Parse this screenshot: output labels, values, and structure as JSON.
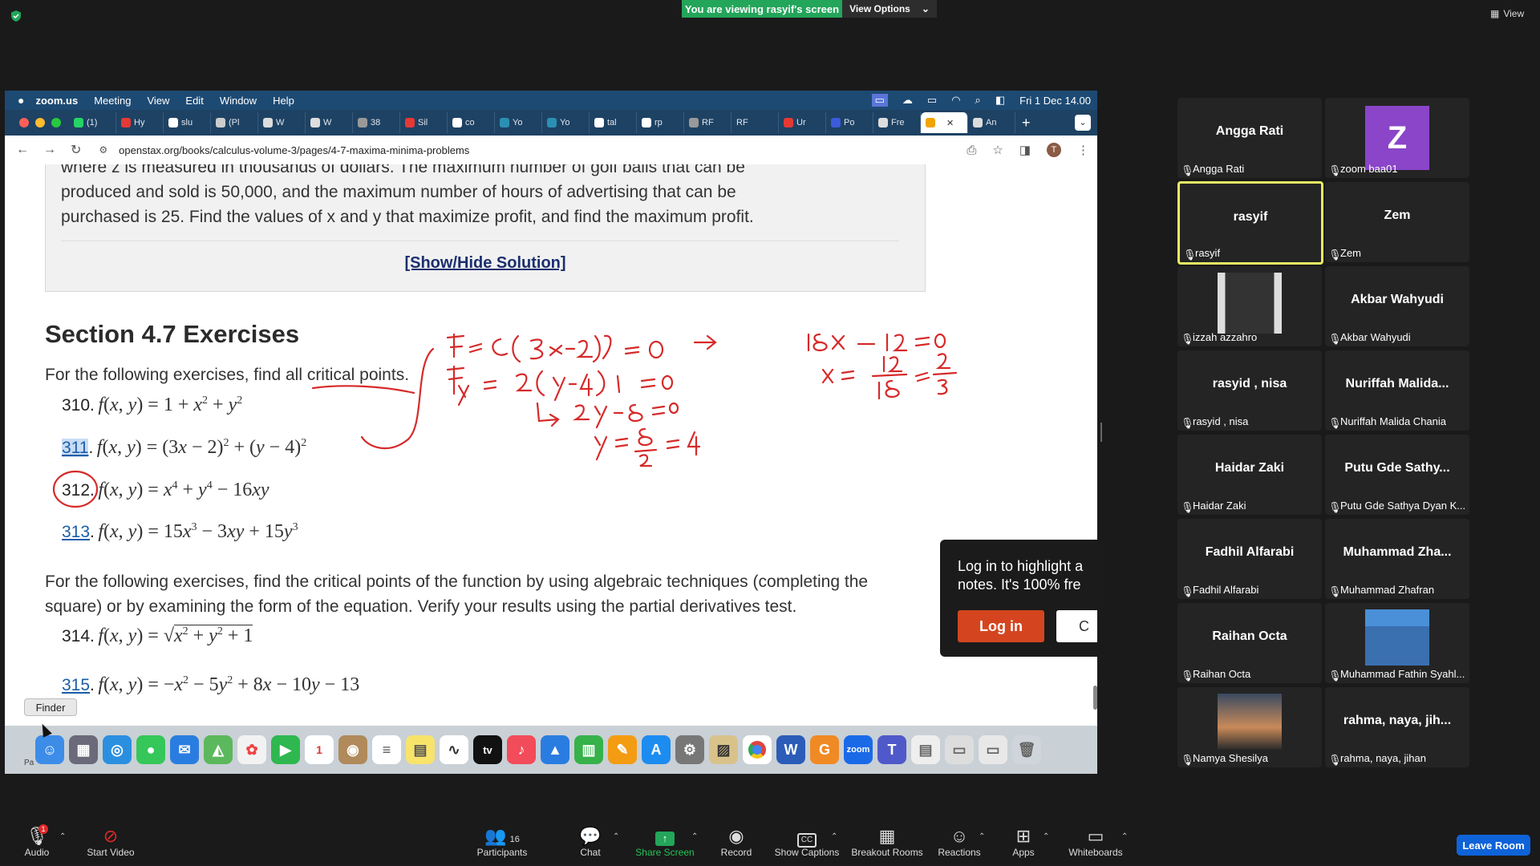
{
  "zoom": {
    "banner": "You are viewing rasyif's screen",
    "view_options": "View Options",
    "view_label": "View"
  },
  "mac": {
    "menu": [
      "zoom.us",
      "Meeting",
      "View",
      "Edit",
      "Window",
      "Help"
    ],
    "datetime": "Fri 1 Dec  14.00"
  },
  "browser": {
    "tabs": [
      "(1)",
      "Hy",
      "slu",
      "(Pl",
      "W",
      "W",
      "38",
      "Sil",
      "co",
      "Yo",
      "Yo",
      "tal",
      "rp",
      "RF",
      "RF",
      "Ur",
      "Po",
      "Fre",
      "",
      "An"
    ],
    "url": "openstax.org/books/calculus-volume-3/pages/4-7-maxima-minima-problems",
    "profile_initial": "T"
  },
  "page": {
    "example_lines": [
      "where z is measured in thousands of dollars. The maximum number of golf balls that can be",
      "produced and sold is 50,000, and the maximum number of hours of advertising that can be",
      "purchased is 25. Find the values of x and y that maximize profit, and find the maximum profit."
    ],
    "show_hide": "[Show/Hide Solution]",
    "section_title": "Section 4.7 Exercises",
    "intro1": "For the following exercises, find all critical points.",
    "ex310_num": "310.",
    "ex311_num": "311",
    "ex312_num": "312.",
    "ex313_num": "313",
    "intro2_line1": "For the following exercises, find the critical points of the function by using algebraic techniques (completing the",
    "intro2_line2": "square) or by examining the form of the equation. Verify your results using the partial derivatives test.",
    "ex314_num": "314.",
    "ex315_num": "315"
  },
  "popup": {
    "text_line1": "Log in to highlight a",
    "text_line2": "notes. It's 100% fre",
    "login": "Log in",
    "cancel": "C"
  },
  "dock": {
    "tooltip": "Finder",
    "partial_label": "Pa"
  },
  "participants": [
    {
      "display": "Angga Rati",
      "label": "Angga Rati"
    },
    {
      "display": "Z",
      "label": "zoom baa01"
    },
    {
      "display": "rasyif",
      "label": "rasyif"
    },
    {
      "display": "Zem",
      "label": "Zem"
    },
    {
      "display": "",
      "label": "izzah azzahro"
    },
    {
      "display": "Akbar Wahyudi",
      "label": "Akbar Wahyudi"
    },
    {
      "display": "rasyid , nisa",
      "label": "rasyid , nisa"
    },
    {
      "display": "Nuriffah  Malida...",
      "label": "Nuriffah Malida Chania"
    },
    {
      "display": "Haidar Zaki",
      "label": "Haidar Zaki"
    },
    {
      "display": "Putu Gde Sathy...",
      "label": "Putu Gde Sathya Dyan K..."
    },
    {
      "display": "Fadhil Alfarabi",
      "label": "Fadhil Alfarabi"
    },
    {
      "display": "Muhammad  Zha...",
      "label": "Muhammad Zhafran"
    },
    {
      "display": "Raihan Octa",
      "label": "Raihan Octa"
    },
    {
      "display": "",
      "label": "Muhammad Fathin Syahl..."
    },
    {
      "display": "",
      "label": "Namya Shesilya"
    },
    {
      "display": "rahma,  naya,  jih...",
      "label": "rahma, naya, jihan"
    }
  ],
  "toolbar": {
    "audio": "Audio",
    "start_video": "Start Video",
    "participants": "Participants",
    "participant_count": "16",
    "chat": "Chat",
    "share_screen": "Share Screen",
    "record": "Record",
    "show_captions": "Show Captions",
    "breakout_rooms": "Breakout Rooms",
    "reactions": "Reactions",
    "apps": "Apps",
    "whiteboards": "Whiteboards",
    "leave": "Leave Room",
    "audio_badge": "1"
  },
  "colors": {
    "zoom_green": "#23a55a",
    "leave_blue": "#0e63d8",
    "active_speaker": "#e6ef62",
    "annotation_red": "#d62a2a",
    "link_blue": "#1a5ea8"
  }
}
